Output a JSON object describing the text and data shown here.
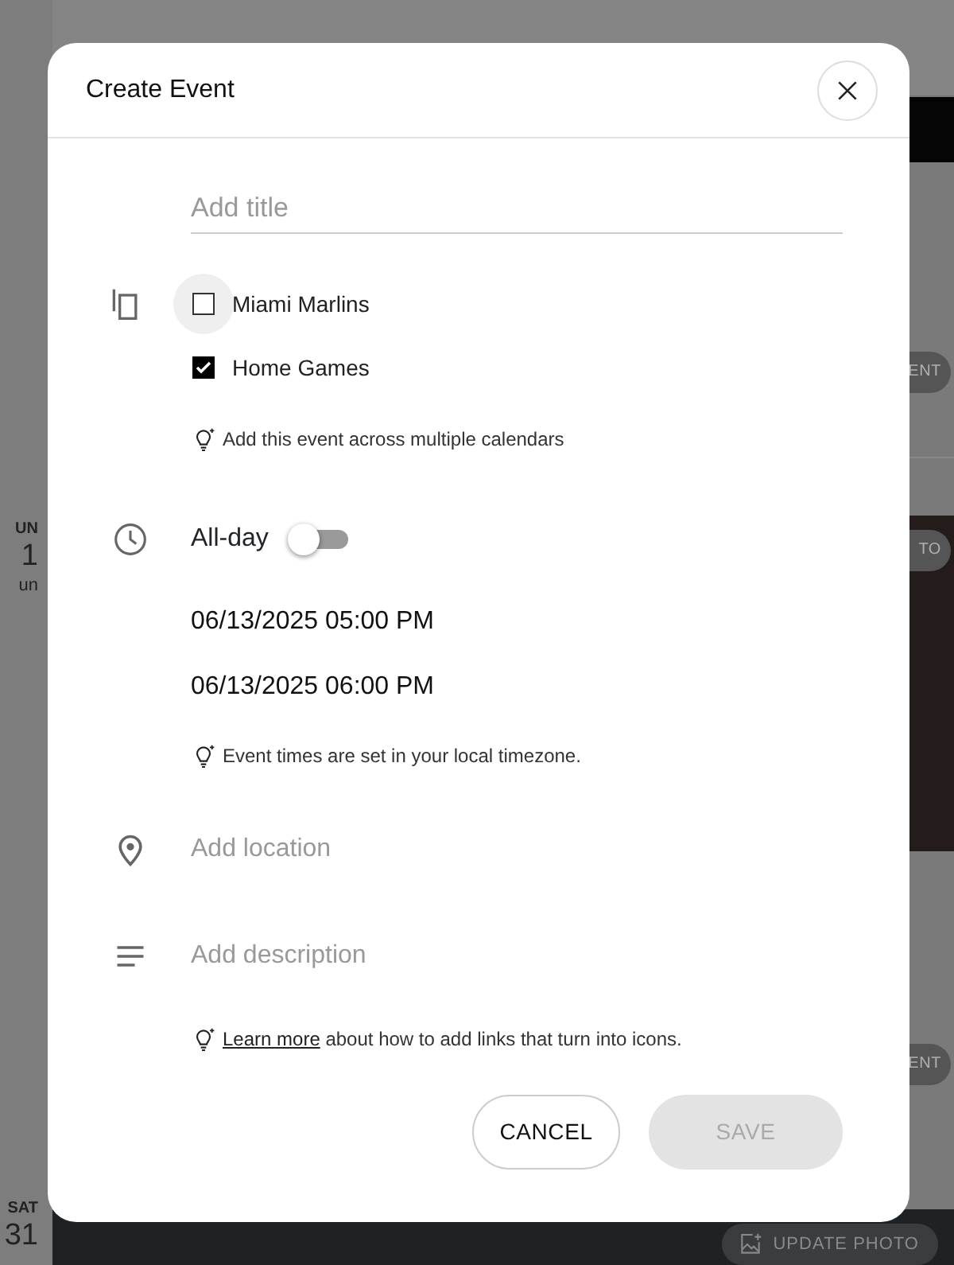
{
  "background": {
    "day_labels": [
      {
        "weekday": "UN",
        "day": "1",
        "sub": "un"
      },
      {
        "weekday": "SAT",
        "day": "31"
      }
    ],
    "buttons": [
      {
        "label": "ENT",
        "kind": "plain"
      },
      {
        "label": "TO",
        "kind": "plain"
      },
      {
        "label": "ENT",
        "kind": "plain"
      },
      {
        "label": "UPDATE PHOTO",
        "kind": "photo"
      }
    ]
  },
  "dialog": {
    "title": "Create Event",
    "title_field": {
      "placeholder": "Add title"
    },
    "calendars": [
      {
        "label": "Miami Marlins",
        "checked": false,
        "focused": true
      },
      {
        "label": "Home Games",
        "checked": true,
        "focused": false
      }
    ],
    "calendars_hint": "Add this event across multiple calendars",
    "all_day": {
      "label": "All-day",
      "on": false
    },
    "start": "06/13/2025 05:00 PM",
    "end": "06/13/2025 06:00 PM",
    "time_hint": "Event times are set in your local timezone.",
    "location": {
      "placeholder": "Add location"
    },
    "description": {
      "placeholder": "Add description"
    },
    "links_hint": {
      "link": "Learn more",
      "text": " about how to add links that turn into icons."
    },
    "buttons": [
      {
        "label": "CANCEL",
        "kind": "outline",
        "disabled": false
      },
      {
        "label": "SAVE",
        "kind": "filled",
        "disabled": true
      }
    ]
  }
}
